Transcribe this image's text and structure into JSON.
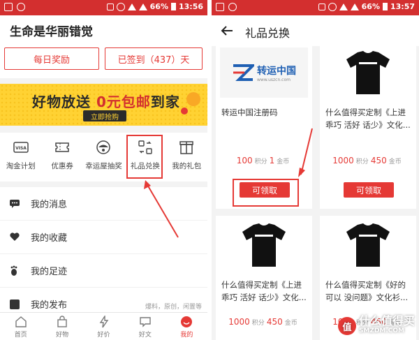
{
  "left": {
    "status": {
      "battery": "66%",
      "time": "13:56"
    },
    "header_title": "生命是华丽错觉",
    "daily_reward_label": "每日奖励",
    "checked_in_label": "已签到（437）天",
    "banner": {
      "title_prefix": "好物放送 ",
      "title_highlight": "0元包邮",
      "title_suffix": "到家",
      "button_label": "立即抢购"
    },
    "shortcuts": [
      {
        "label": "淘金计划",
        "icon": "visa-card-icon"
      },
      {
        "label": "优惠券",
        "icon": "coupon-ticket-icon"
      },
      {
        "label": "幸运屋抽奖",
        "icon": "lucky-house-icon"
      },
      {
        "label": "礼品兑换",
        "icon": "exchange-icon"
      },
      {
        "label": "我的礼包",
        "icon": "gift-box-icon"
      }
    ],
    "menu": [
      {
        "label": "我的消息",
        "icon": "message-icon",
        "hint": ""
      },
      {
        "label": "我的收藏",
        "icon": "heart-icon",
        "hint": ""
      },
      {
        "label": "我的足迹",
        "icon": "footprint-icon",
        "hint": ""
      },
      {
        "label": "我的发布",
        "icon": "publish-icon",
        "hint": "爆料，原创，闲置等"
      }
    ],
    "tabs": [
      {
        "label": "首页",
        "icon": "home-icon"
      },
      {
        "label": "好物",
        "icon": "bag-icon"
      },
      {
        "label": "好价",
        "icon": "lightning-icon"
      },
      {
        "label": "好文",
        "icon": "chat-icon"
      },
      {
        "label": "我的",
        "icon": "profile-icon"
      }
    ]
  },
  "right": {
    "status": {
      "battery": "66%",
      "time": "13:57"
    },
    "header_title": "礼品兑换",
    "cards": [
      {
        "title": "转运中国注册码",
        "points": "100",
        "points_unit": "积分",
        "coins": "1",
        "coins_unit": "金币",
        "button": "可领取",
        "image": "logo",
        "logo_text": "转运中国",
        "logo_sub": "www.uszcn.com"
      },
      {
        "title": "什么值得买定制《上进乖巧 活好 话少》文化...",
        "points": "1000",
        "points_unit": "积分",
        "coins": "450",
        "coins_unit": "金币",
        "button": "可领取",
        "image": "tshirt"
      },
      {
        "title": "什么值得买定制《上进乖巧 活好 话少》文化...",
        "points": "1000",
        "points_unit": "积分",
        "coins": "450",
        "coins_unit": "金币",
        "button": "",
        "image": "tshirt"
      },
      {
        "title": "什么值得买定制《好的可以 没问题》文化衫...",
        "points": "1000",
        "points_unit": "积分",
        "coins": "450",
        "coins_unit": "金币",
        "button": "",
        "image": "tshirt"
      }
    ],
    "watermark": {
      "badge": "值",
      "line1": "什么值得买",
      "line2": "SMZDM.COM"
    }
  },
  "colors": {
    "brand_red": "#e53935",
    "status_red": "#d32f2f",
    "banner_yellow": "#ffd233"
  }
}
